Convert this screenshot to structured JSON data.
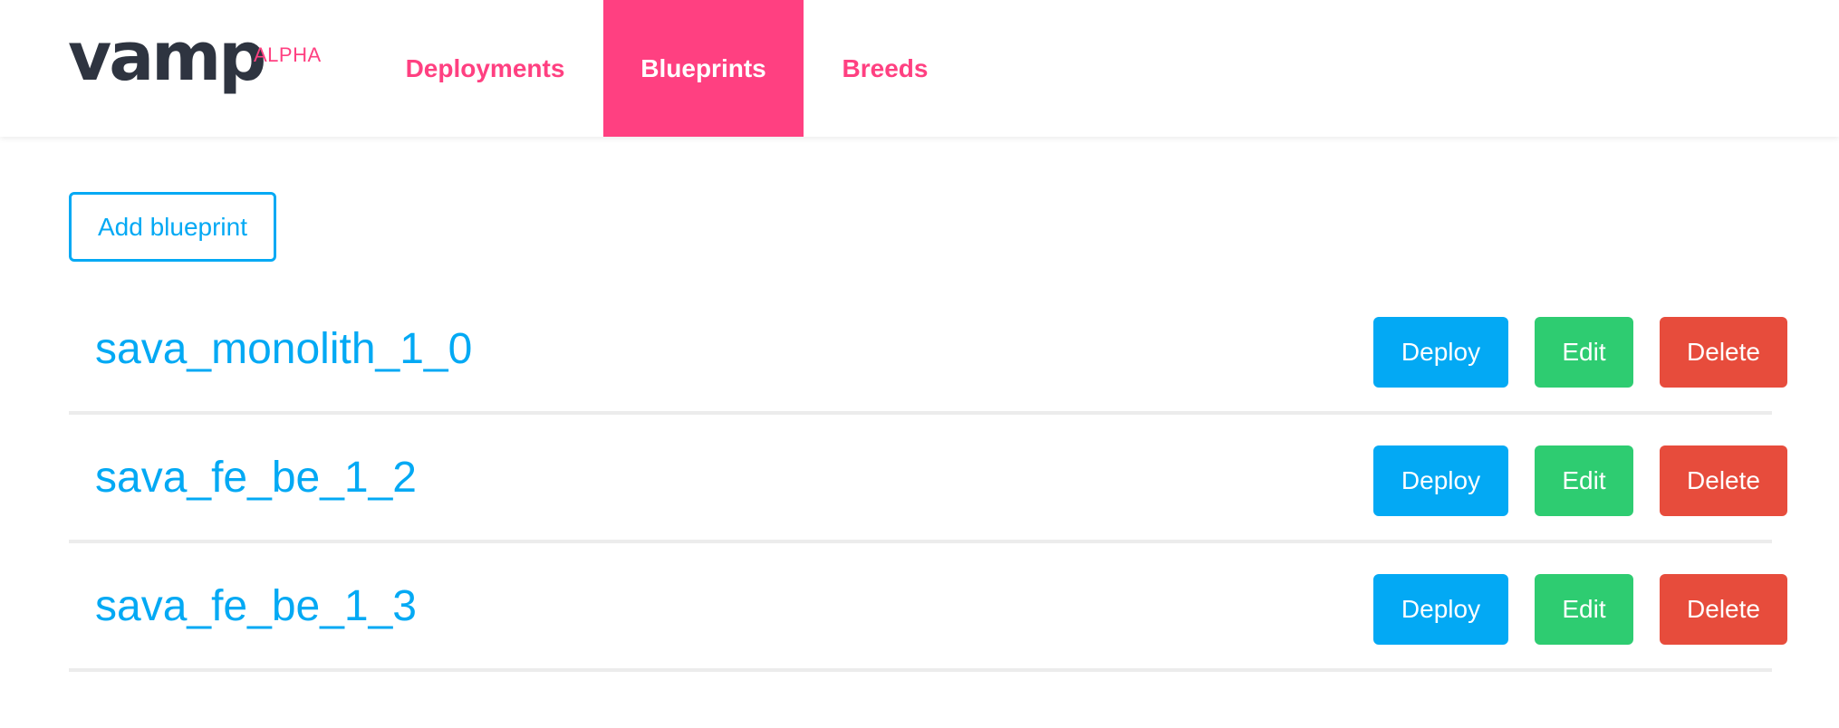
{
  "header": {
    "logo_text": "vamp",
    "logo_badge": "ALPHA",
    "nav": [
      {
        "label": "Deployments",
        "active": false
      },
      {
        "label": "Blueprints",
        "active": true
      },
      {
        "label": "Breeds",
        "active": false
      }
    ]
  },
  "actions": {
    "add_label": "Add blueprint"
  },
  "blueprints": [
    {
      "name": "sava_monolith_1_0",
      "deploy": "Deploy",
      "edit": "Edit",
      "delete": "Delete"
    },
    {
      "name": "sava_fe_be_1_2",
      "deploy": "Deploy",
      "edit": "Edit",
      "delete": "Delete"
    },
    {
      "name": "sava_fe_be_1_3",
      "deploy": "Deploy",
      "edit": "Edit",
      "delete": "Delete"
    }
  ],
  "colors": {
    "brand_pink": "#ff4081",
    "primary_blue": "#03a9f4",
    "edit_green": "#2ecc71",
    "delete_red": "#e74c3c",
    "logo_dark": "#2e3440"
  }
}
